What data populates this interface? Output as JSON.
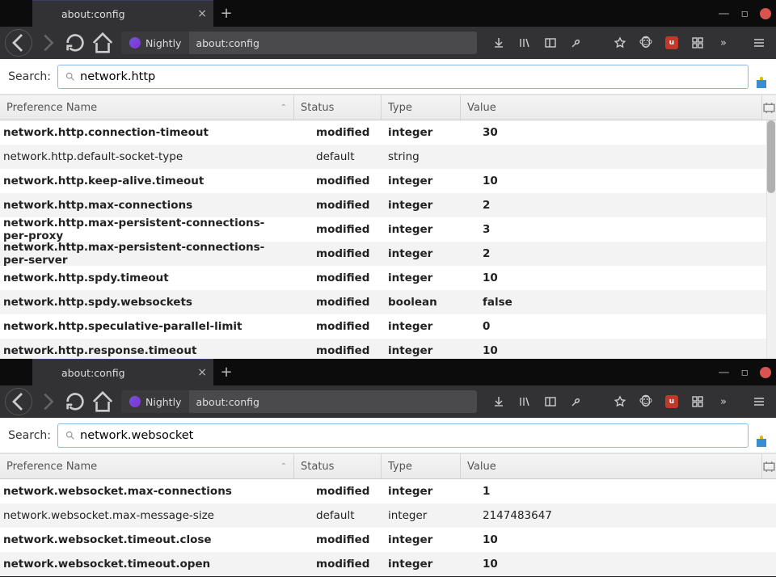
{
  "windows": [
    {
      "tab": {
        "title": "about:config"
      },
      "toolbar": {
        "nightly_label": "Nightly",
        "url": "about:config"
      },
      "search": {
        "label": "Search:",
        "value": "network.http"
      },
      "headers": {
        "name": "Preference Name",
        "status": "Status",
        "type": "Type",
        "value": "Value"
      },
      "rows": [
        {
          "name": "network.http.connection-timeout",
          "status": "modified",
          "type": "integer",
          "value": "30",
          "modified": true
        },
        {
          "name": "network.http.default-socket-type",
          "status": "default",
          "type": "string",
          "value": "",
          "modified": false
        },
        {
          "name": "network.http.keep-alive.timeout",
          "status": "modified",
          "type": "integer",
          "value": "10",
          "modified": true
        },
        {
          "name": "network.http.max-connections",
          "status": "modified",
          "type": "integer",
          "value": "2",
          "modified": true
        },
        {
          "name": "network.http.max-persistent-connections-per-proxy",
          "status": "modified",
          "type": "integer",
          "value": "3",
          "modified": true
        },
        {
          "name": "network.http.max-persistent-connections-per-server",
          "status": "modified",
          "type": "integer",
          "value": "2",
          "modified": true
        },
        {
          "name": "network.http.spdy.timeout",
          "status": "modified",
          "type": "integer",
          "value": "10",
          "modified": true
        },
        {
          "name": "network.http.spdy.websockets",
          "status": "modified",
          "type": "boolean",
          "value": "false",
          "modified": true
        },
        {
          "name": "network.http.speculative-parallel-limit",
          "status": "modified",
          "type": "integer",
          "value": "0",
          "modified": true
        },
        {
          "name": "network.http.response.timeout",
          "status": "modified",
          "type": "integer",
          "value": "10",
          "modified": true
        }
      ],
      "scroll_height": 295,
      "thumb_height": 90
    },
    {
      "tab": {
        "title": "about:config"
      },
      "toolbar": {
        "nightly_label": "Nightly",
        "url": "about:config"
      },
      "search": {
        "label": "Search:",
        "value": "network.websocket"
      },
      "headers": {
        "name": "Preference Name",
        "status": "Status",
        "type": "Type",
        "value": "Value"
      },
      "rows": [
        {
          "name": "network.websocket.max-connections",
          "status": "modified",
          "type": "integer",
          "value": "1",
          "modified": true
        },
        {
          "name": "network.websocket.max-message-size",
          "status": "default",
          "type": "integer",
          "value": "2147483647",
          "modified": false
        },
        {
          "name": "network.websocket.timeout.close",
          "status": "modified",
          "type": "integer",
          "value": "10",
          "modified": true
        },
        {
          "name": "network.websocket.timeout.open",
          "status": "modified",
          "type": "integer",
          "value": "10",
          "modified": true
        }
      ],
      "scroll_height": 120,
      "thumb_height": 60
    }
  ]
}
